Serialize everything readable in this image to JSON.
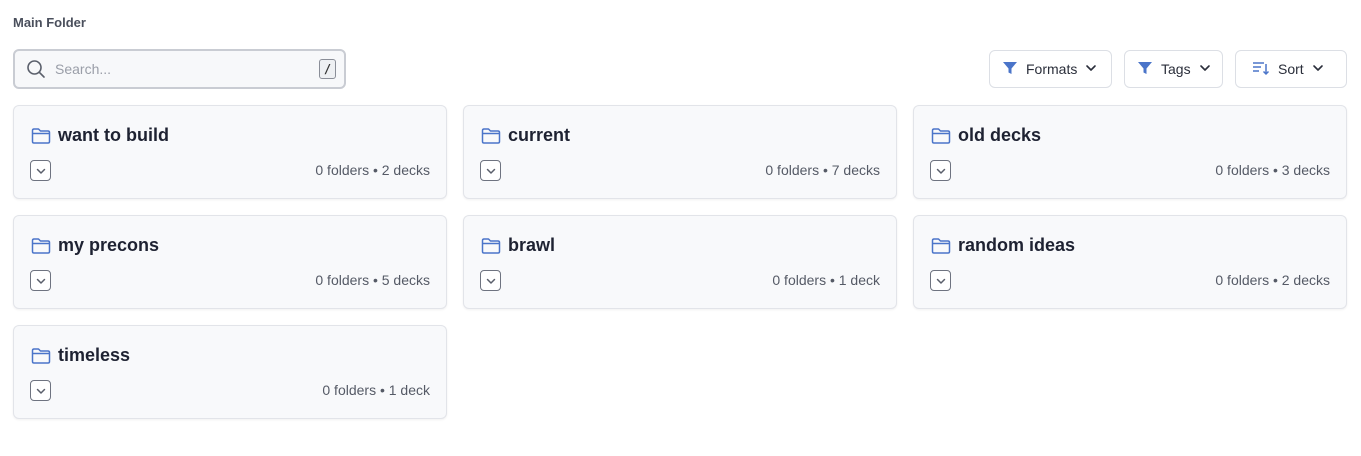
{
  "page_title": "Main Folder",
  "search": {
    "placeholder": "Search...",
    "shortcut": "/"
  },
  "toolbar": {
    "formats_label": "Formats",
    "tags_label": "Tags",
    "sort_label": "Sort"
  },
  "colors": {
    "accent": "#4a74c9",
    "card_bg": "#f8f9fb",
    "border": "#e2e4e9"
  },
  "folders": [
    {
      "name": "want to build",
      "meta": "0 folders • 2 decks"
    },
    {
      "name": "current",
      "meta": "0 folders • 7 decks"
    },
    {
      "name": "old decks",
      "meta": "0 folders • 3 decks"
    },
    {
      "name": "my precons",
      "meta": "0 folders • 5 decks"
    },
    {
      "name": "brawl",
      "meta": "0 folders • 1 deck"
    },
    {
      "name": "random ideas",
      "meta": "0 folders • 2 decks"
    },
    {
      "name": "timeless",
      "meta": "0 folders • 1 deck"
    }
  ]
}
